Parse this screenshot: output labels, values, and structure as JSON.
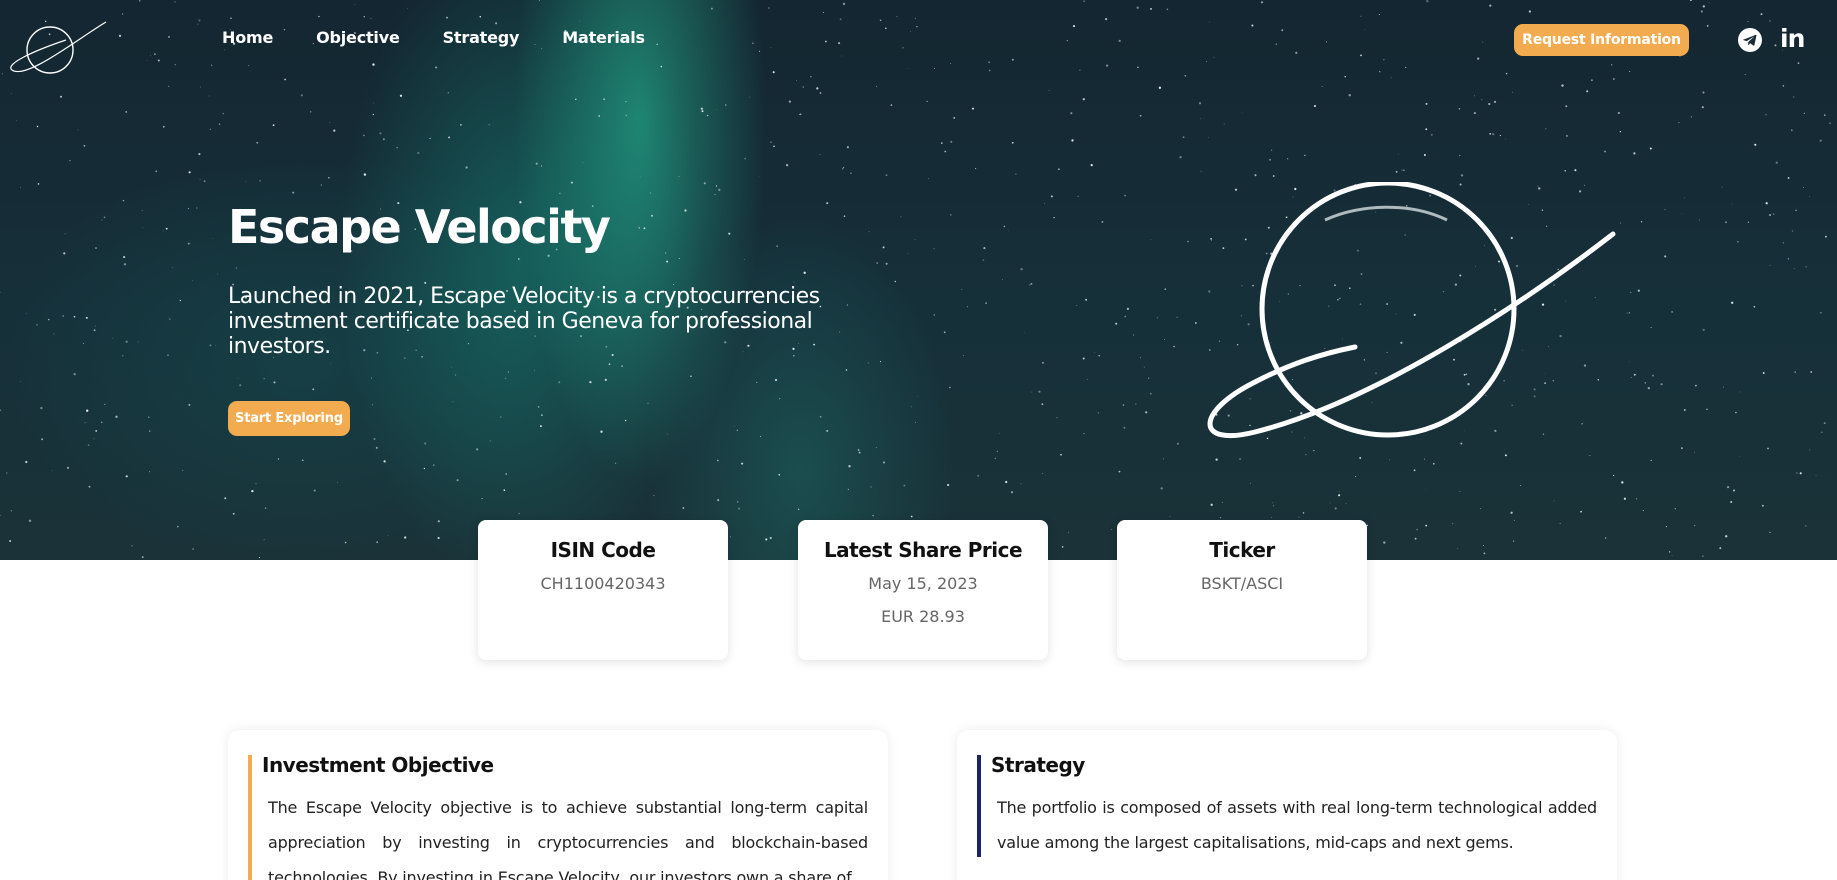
{
  "nav": {
    "items": [
      "Home",
      "Objective",
      "Strategy",
      "Materials"
    ],
    "request_label": "Request Information"
  },
  "icons": {
    "logo": "planet-logo-icon",
    "telegram": "telegram-icon",
    "linkedin": "linkedin-icon",
    "linkedin_glyph": "in"
  },
  "hero": {
    "title": "Escape Velocity",
    "subtitle": "Launched in 2021, Escape Velocity is a cryptocurrencies investment certificate based in Geneva for professional investors.",
    "cta_label": "Start Exploring"
  },
  "cards": [
    {
      "title": "ISIN Code",
      "value": "CH1100420343"
    },
    {
      "title": "Latest Share Price",
      "value": "May 15, 2023",
      "value2": "EUR 28.93"
    },
    {
      "title": "Ticker",
      "value": "BSKT/ASCI"
    }
  ],
  "panels": [
    {
      "title": "Investment Objective",
      "text": "The Escape Velocity objective is to achieve substantial long-term capital appreciation by investing in cryptocurrencies and blockchain-based technologies. By investing in Escape Velocity, our investors own a share of",
      "accent": "#f2ab4f"
    },
    {
      "title": "Strategy",
      "text": "The portfolio is composed of assets with real long-term technological added value among the largest capitalisations, mid-caps and next gems.",
      "accent": "#1a2466"
    }
  ],
  "colors": {
    "accent_orange": "#f2ab4f",
    "hero_dark": "#142631",
    "aurora_green": "#26c8a0",
    "strategy_navy": "#1a2466"
  }
}
